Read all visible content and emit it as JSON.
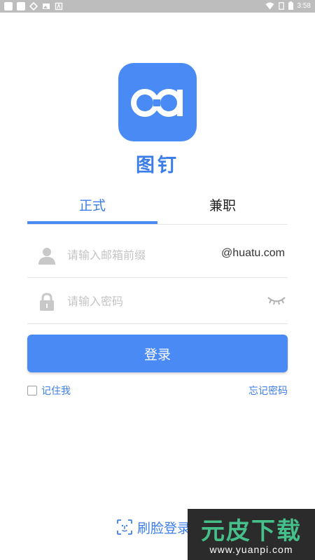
{
  "status_bar": {
    "time": "3:58"
  },
  "app": {
    "name": "图钉"
  },
  "tabs": [
    {
      "label": "正式",
      "active": true
    },
    {
      "label": "兼职",
      "active": false
    }
  ],
  "form": {
    "email_placeholder": "请输入邮箱前缀",
    "email_value": "",
    "email_domain": "@huatu.com",
    "password_placeholder": "请输入密码",
    "password_value": ""
  },
  "login_button": {
    "label": "登录"
  },
  "remember_me": {
    "label": "记住我",
    "checked": false
  },
  "forgot_password": {
    "label": "忘记密码"
  },
  "face_login": {
    "label": "刷脸登录"
  },
  "watermark": {
    "title": "元皮下载",
    "url": "www.yuanpi.com"
  },
  "colors": {
    "accent": "#4a8af4",
    "link": "#3d7de8",
    "divider": "#e4e4e4",
    "placeholder": "#c4c4c4"
  },
  "icons": [
    "user-icon",
    "lock-icon",
    "eye-closed-icon",
    "face-scan-icon",
    "wifi-icon",
    "battery-icon"
  ]
}
